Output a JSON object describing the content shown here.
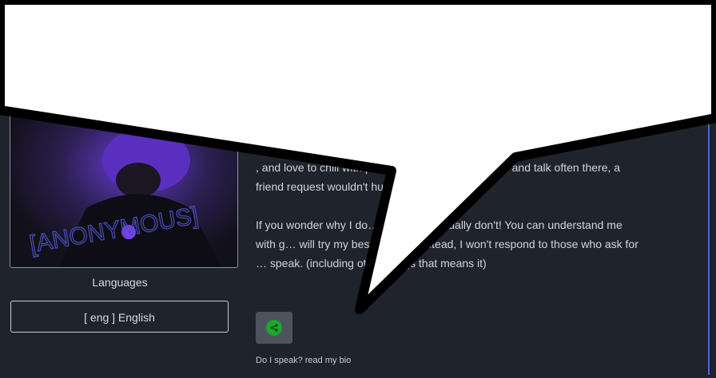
{
  "profile": {
    "image_overlay_text": "[ANONYMOUS]",
    "languages_heading": "Languages",
    "language": "[ eng ] English"
  },
  "bio": {
    "paragraph_1": ", and love to chill with people while having fun. If … and talk often there, a friend request wouldn't hu…",
    "paragraph_2": "If you wonder why I do… because I actually don't! You can understand me with g… will try my best to show instead, I won't respond to those who ask for … speak.   (including other things that means it)"
  },
  "share": {
    "icon": "share-icon",
    "color": "#1aa82e"
  },
  "caption": "Do I speak? read my bio",
  "colors": {
    "background": "#1f232c",
    "accent_edge": "#3f6fd6"
  }
}
